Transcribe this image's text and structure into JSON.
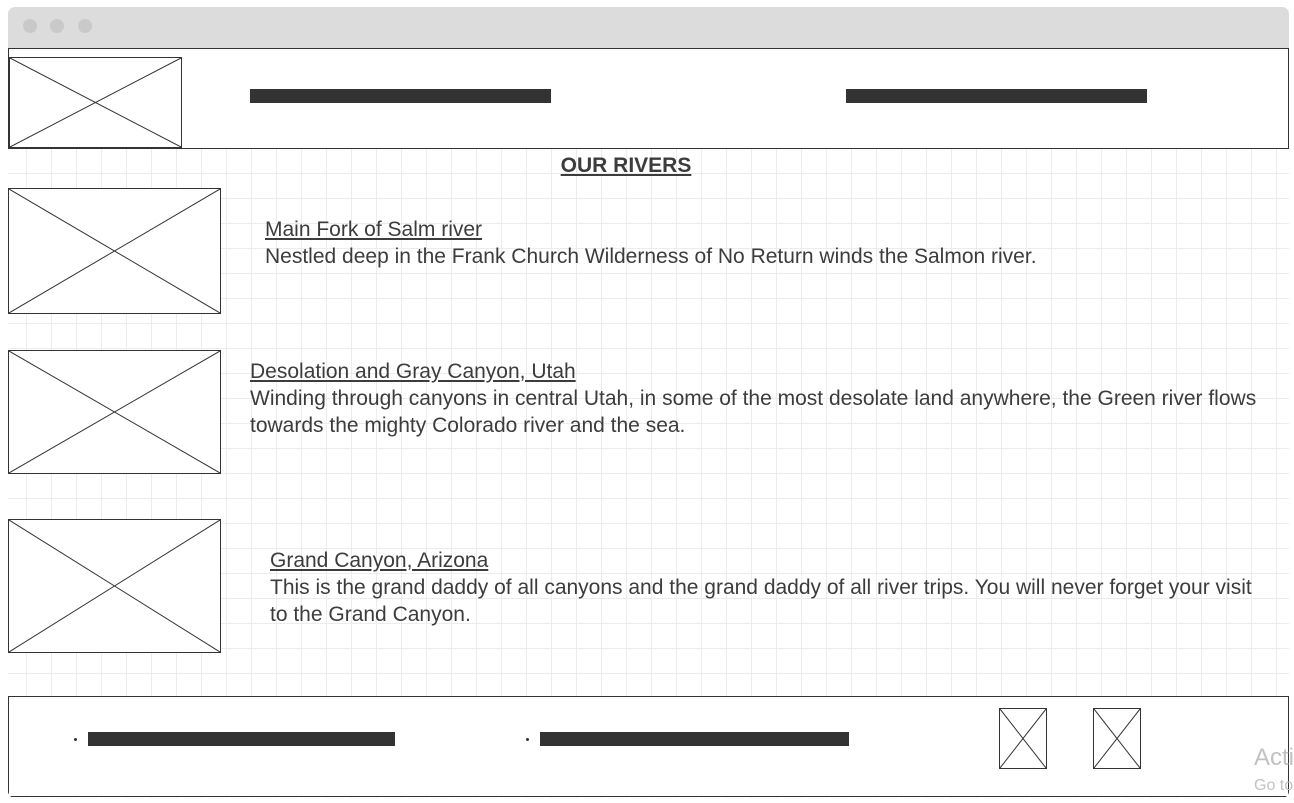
{
  "page": {
    "title": "OUR RIVERS"
  },
  "rivers": [
    {
      "name": "Main Fork of Salm river",
      "description": "Nestled deep in the Frank Church Wilderness of No Return winds the Salmon river."
    },
    {
      "name": "Desolation and Gray Canyon, Utah",
      "description": "Winding through canyons in central Utah, in some of the most desolate land anywhere, the Green river flows towards the mighty Colorado river and the sea."
    },
    {
      "name": "Grand Canyon, Arizona",
      "description": "This is the grand daddy of all canyons and the grand daddy of all river trips. You will never forget your visit to the Grand Canyon."
    }
  ],
  "watermark": {
    "line1": "Acti",
    "line2": "Go to"
  },
  "colors": {
    "ink": "#333333",
    "text": "#3c3c3c",
    "grid": "#ececec",
    "titlebar": "#dcdcdc"
  }
}
